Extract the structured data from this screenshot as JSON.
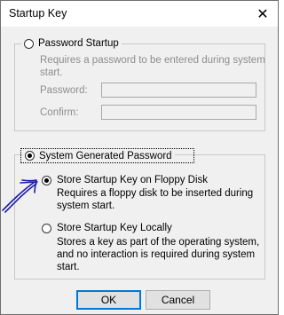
{
  "window": {
    "title": "Startup Key",
    "close_icon": "close-icon"
  },
  "password_startup": {
    "label": "Password Startup",
    "description_line1": "Requires a password to be entered during system",
    "description_line2": "start.",
    "password_label": "Password:",
    "confirm_label": "Confirm:",
    "password_value": "",
    "confirm_value": "",
    "selected": false
  },
  "system_generated": {
    "label": "System Generated Password",
    "selected": true,
    "floppy": {
      "label": "Store Startup Key on Floppy Disk",
      "description_line1": "Requires a floppy disk to be inserted during",
      "description_line2": "system start.",
      "selected": true
    },
    "locally": {
      "label": "Store Startup Key Locally",
      "description_line1": "Stores a key as part of the operating system,",
      "description_line2": "and no interaction is required during system",
      "description_line3": "start.",
      "selected": false
    }
  },
  "buttons": {
    "ok": "OK",
    "cancel": "Cancel"
  },
  "annotation": {
    "arrow_color": "#1a1aa8",
    "icon": "hand-drawn-arrow-icon"
  }
}
